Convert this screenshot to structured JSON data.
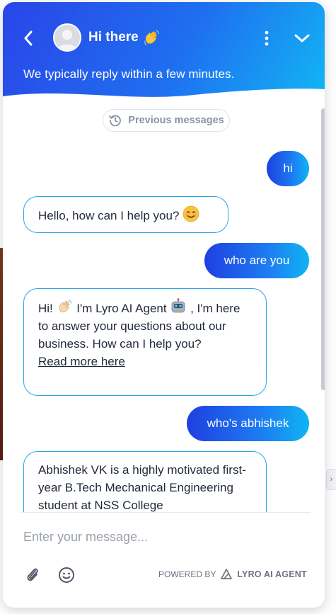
{
  "header": {
    "title": "Hi there",
    "title_emoji": "waving-hand",
    "subtitle": "We typically reply within a few minutes."
  },
  "messages_area": {
    "previous_label": "Previous messages"
  },
  "messages": [
    {
      "from": "user",
      "text": "hi"
    },
    {
      "from": "agent",
      "text": "Hello, how can I help you?",
      "emoji": "smiling-face"
    },
    {
      "from": "user",
      "text": "who are you"
    },
    {
      "from": "agent",
      "parts": [
        "Hi!",
        "I'm Lyro AI Agent",
        ", I'm here to answer your questions about our business. How can I help you?"
      ],
      "link": "Read more here"
    },
    {
      "from": "user",
      "text": "who's abhishek"
    },
    {
      "from": "agent",
      "text": "Abhishek VK is a highly motivated first-year B.Tech Mechanical Engineering student at NSS College"
    }
  ],
  "composer": {
    "placeholder": "Enter your message...",
    "powered_prefix": "POWERED BY",
    "brand": "LYRO AI AGENT"
  },
  "colors": {
    "header_gradient_start": "#2a45e8",
    "header_gradient_end": "#12b6f4",
    "agent_bubble_border": "#29a6e8",
    "user_bubble_start": "#1f3fe0",
    "user_bubble_end": "#0fb4f3"
  }
}
